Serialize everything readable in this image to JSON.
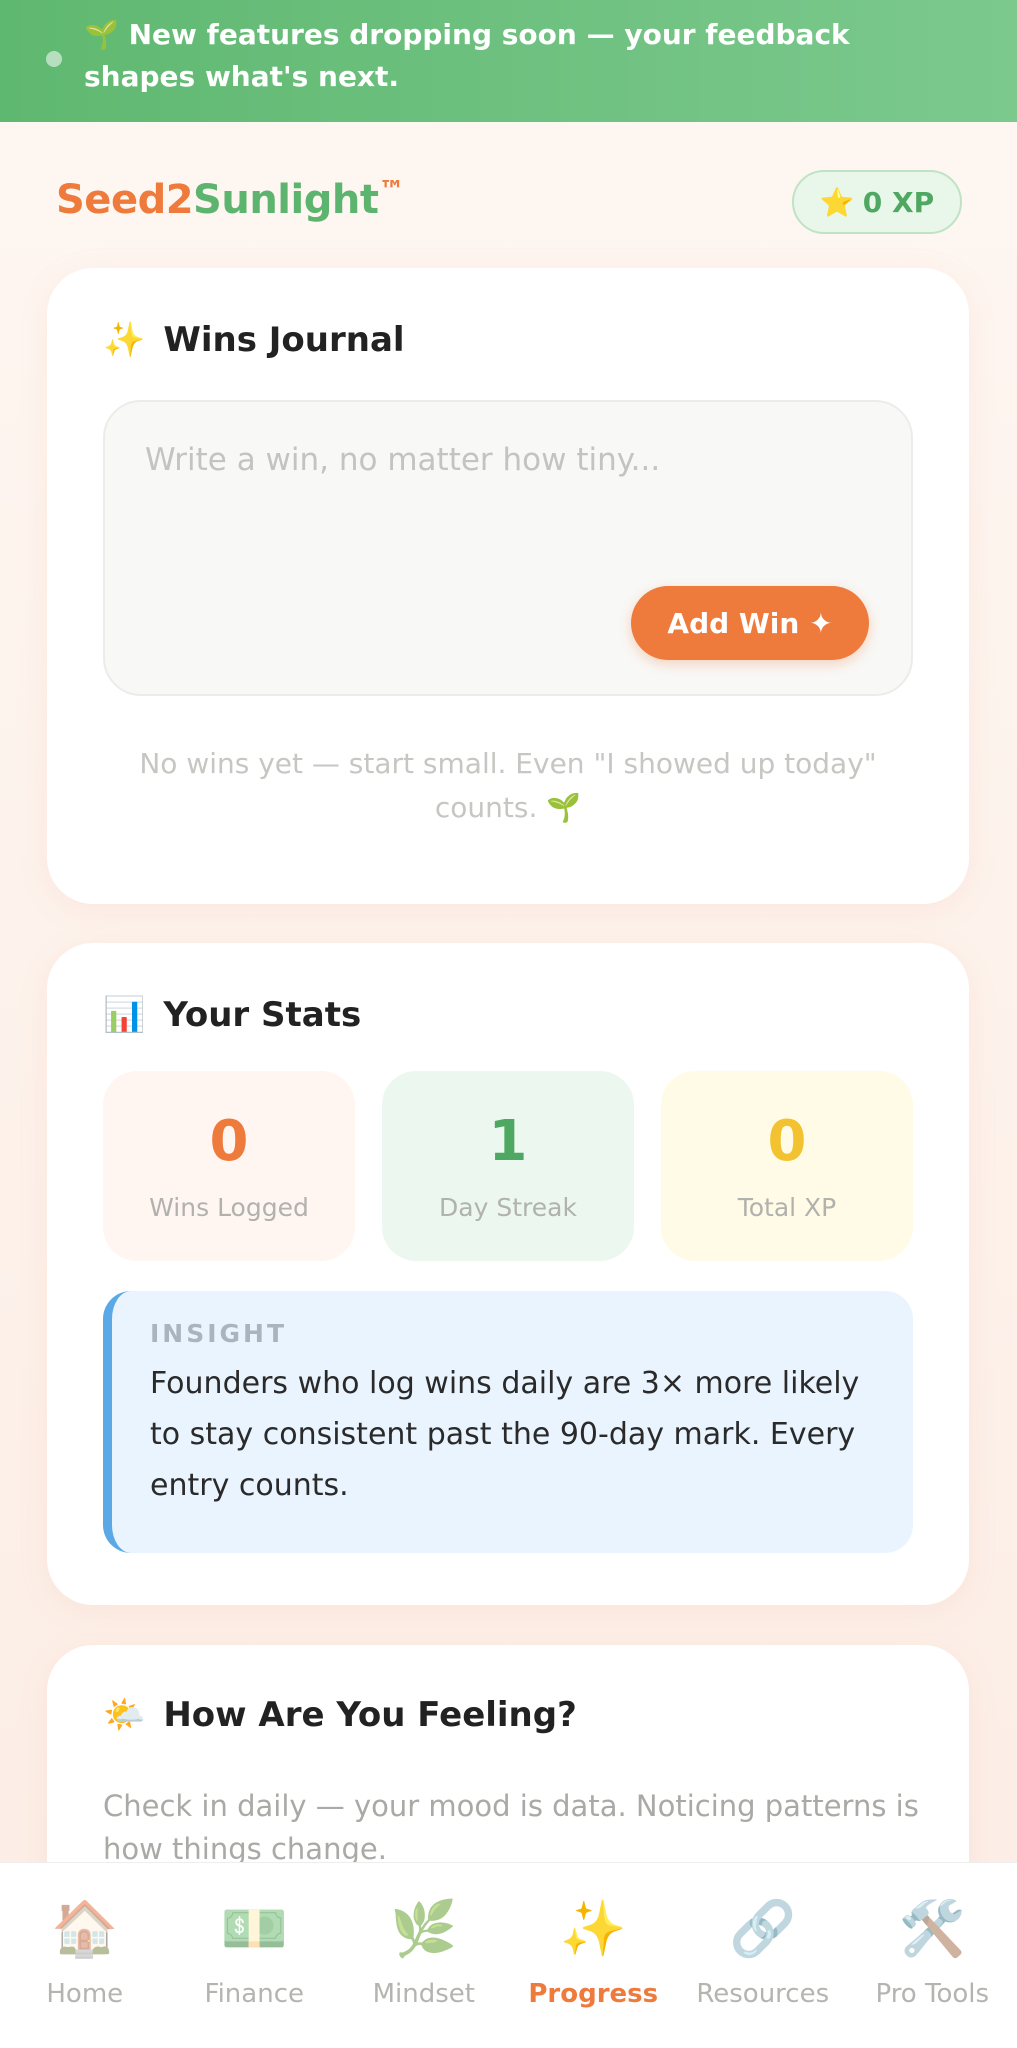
{
  "banner": {
    "icon": "🌱",
    "text": "New features dropping soon — your feedback shapes what's next."
  },
  "header": {
    "brand_part1": "Seed2",
    "brand_part2": "Sunlight",
    "brand_tm": "™",
    "xp_icon": "⭐",
    "xp_label": "0 XP"
  },
  "wins": {
    "icon": "✨",
    "title": "Wins Journal",
    "placeholder": "Write a win, no matter how tiny...",
    "add_label": "Add Win ✦",
    "empty_text": "No wins yet — start small. Even \"I showed up today\" counts. 🌱"
  },
  "stats": {
    "icon": "📊",
    "title": "Your Stats",
    "items": [
      {
        "value": "0",
        "label": "Wins Logged",
        "color": "#ee7a3c",
        "bg": "#fff6f1"
      },
      {
        "value": "1",
        "label": "Day Streak",
        "color": "#4ea862",
        "bg": "#ecf8ef"
      },
      {
        "value": "0",
        "label": "Total XP",
        "color": "#f2c230",
        "bg": "#fffbe6"
      }
    ],
    "insight_kicker": "INSIGHT",
    "insight_body": "Founders who log wins daily are 3× more likely to stay consistent past the 90-day mark. Every entry counts."
  },
  "feeling": {
    "icon": "🌤️",
    "title": "How Are You Feeling?",
    "subtitle": "Check in daily — your mood is data. Noticing patterns is how things change."
  },
  "nav": [
    {
      "icon": "🏠",
      "label": "Home",
      "active": false
    },
    {
      "icon": "💵",
      "label": "Finance",
      "active": false
    },
    {
      "icon": "🌿",
      "label": "Mindset",
      "active": false
    },
    {
      "icon": "✨",
      "label": "Progress",
      "active": true
    },
    {
      "icon": "🔗",
      "label": "Resources",
      "active": false
    },
    {
      "icon": "🛠️",
      "label": "Pro Tools",
      "active": false
    }
  ]
}
